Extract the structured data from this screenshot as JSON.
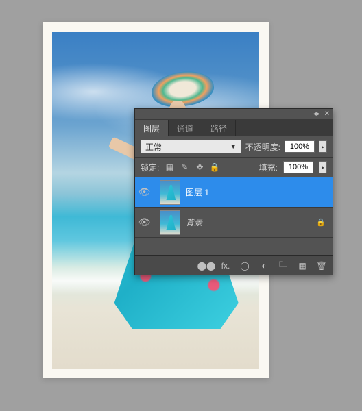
{
  "panel": {
    "tabs": {
      "layers": "图层",
      "channels": "通道",
      "paths": "路径"
    },
    "blendMode": "正常",
    "opacity": {
      "label": "不透明度:",
      "value": "100%"
    },
    "lock": {
      "label": "锁定:"
    },
    "fill": {
      "label": "填充:",
      "value": "100%"
    },
    "layers": [
      {
        "name": "图层 1",
        "locked": false
      },
      {
        "name": "背景",
        "locked": true
      }
    ],
    "icons": {
      "collapse": "◂▸",
      "close": "✕",
      "dropdown": "▼",
      "eye": "👁",
      "lockPixel": "▦",
      "lockBrush": "✎",
      "lockMove": "✥",
      "lockAll": "🔒",
      "link": "⬤⬤",
      "fx": "fx.",
      "mask": "◯",
      "adjust": "◐",
      "folder": "🗀",
      "new": "▦",
      "trash": "🗑"
    }
  }
}
